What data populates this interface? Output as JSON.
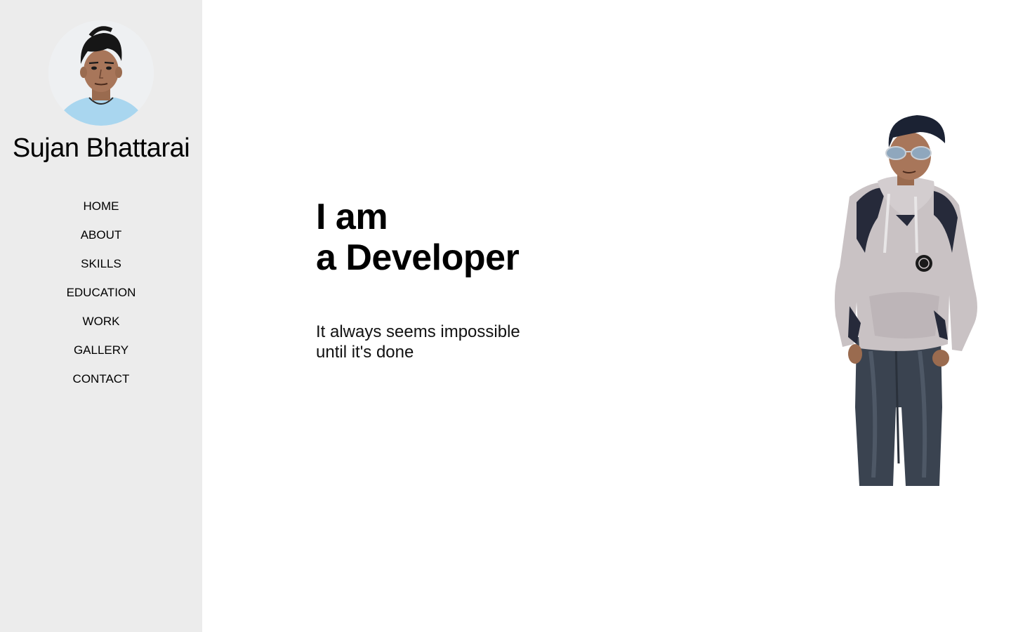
{
  "sidebar": {
    "name": "Sujan Bhattarai",
    "nav": [
      {
        "id": "home",
        "label": "HOME"
      },
      {
        "id": "about",
        "label": "ABOUT"
      },
      {
        "id": "skills",
        "label": "SKILLS"
      },
      {
        "id": "education",
        "label": "EDUCATION"
      },
      {
        "id": "work",
        "label": "WORK"
      },
      {
        "id": "gallery",
        "label": "GALLERY"
      },
      {
        "id": "contact",
        "label": "CONTACT"
      }
    ]
  },
  "hero": {
    "title_line1": "I am",
    "title_line2": "a Developer",
    "tagline_line1": "It always seems impossible",
    "tagline_line2": "until it's done"
  },
  "colors": {
    "sidebar_bg": "#ececec",
    "page_bg": "#ffffff",
    "text": "#000000"
  }
}
